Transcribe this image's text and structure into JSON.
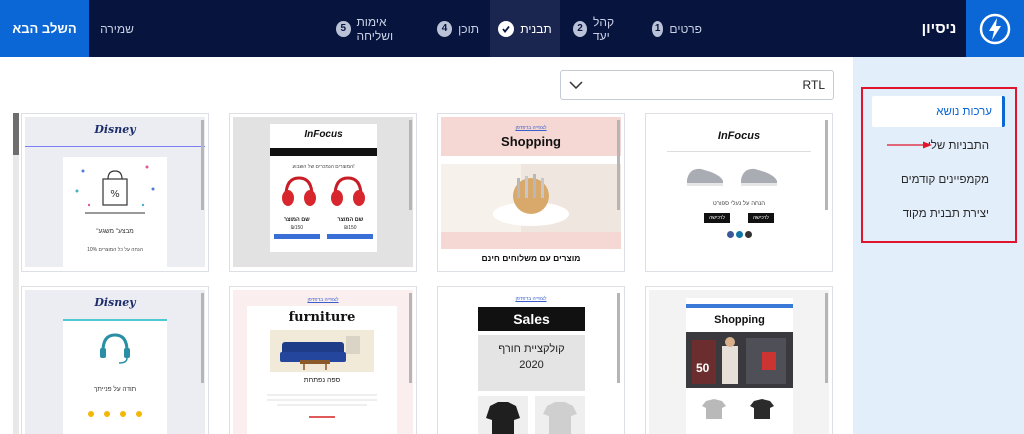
{
  "header": {
    "brand_name": "ניסיון",
    "next_label": "השלב הבא",
    "save_label": "שמירה",
    "steps": [
      {
        "num": "1",
        "label": "פרטים"
      },
      {
        "num": "2",
        "label": "קהל יעד"
      },
      {
        "label": "תבנית"
      },
      {
        "num": "4",
        "label": "תוכן"
      },
      {
        "num": "5",
        "label": "אימות ושליחה"
      }
    ]
  },
  "sidebar": {
    "items": [
      {
        "label": "ערכות נושא"
      },
      {
        "label": "התבניות שלי"
      },
      {
        "label": "מקמפיינים קודמים"
      },
      {
        "label": "יצירת תבנית מקוד"
      }
    ]
  },
  "direction_select": {
    "value": "RTL"
  },
  "colors": {
    "nav_bg": "#07143d",
    "accent": "#0b66d6",
    "highlight": "#e0152d",
    "sidebar_bg": "#e3eefb"
  },
  "templates": {
    "infocus_shoes": {
      "logo": "InFocus",
      "line1": "הנחה על נעלי ספורט",
      "btn": "לרכישה"
    },
    "shopping_pink": {
      "top": "לצפייה בדפדפן",
      "logo": "Shopping",
      "footer": "מוצרים עם משלוחים חינם"
    },
    "infocus_headphones": {
      "logo": "InFocus",
      "heading": "המוצרים הנמכרים של השבוע!",
      "name1": "שם המוצר",
      "name2": "שם המוצר",
      "price1": "₪150",
      "price2": "₪150"
    },
    "disney_sale": {
      "logo": "Disney",
      "title": "\"מבצע\" משגע",
      "text": "10% הנחה על כל המוצרים"
    },
    "shopping_dark": {
      "logo": "Shopping"
    },
    "sales_winter": {
      "top": "לצפייה בדפדפן",
      "logo": "Sales",
      "line1": "קולקציית חורף",
      "line2": "2020"
    },
    "furniture": {
      "top": "לצפייה בדפדפן",
      "logo": "furniture",
      "caption": "ספה נפתחת"
    },
    "disney_thanks": {
      "logo": "Disney",
      "title": "תודה על פנייתך"
    }
  }
}
